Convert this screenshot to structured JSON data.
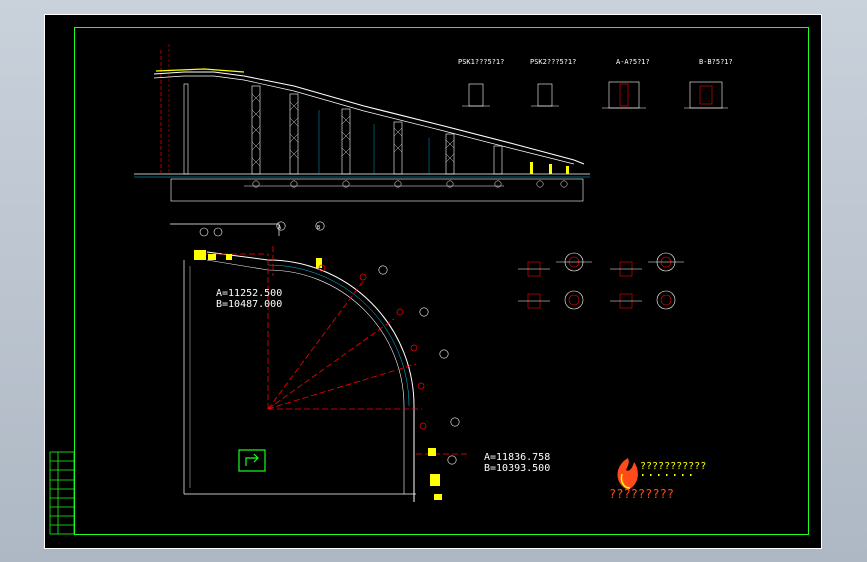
{
  "drawing": {
    "section_labels": [
      "PSK1???5?1?",
      "PSK2???5?1?",
      "A-A?5?1?",
      "B-B?5?1?"
    ],
    "coord_start": {
      "a": "A=11252.500",
      "b": "B=10487.000"
    },
    "coord_end": {
      "a": "A=11836.758",
      "b": "B=10393.500"
    },
    "axis_marks": [
      "A",
      "B"
    ],
    "company_line": "???????????",
    "footer_text": "?????????",
    "colors": {
      "background": "#000000",
      "border": "#1cff1c",
      "linework": "#ff0000",
      "steel": "#ffffff",
      "annotation": "#ffff00",
      "grid": "#00c8ff"
    }
  }
}
